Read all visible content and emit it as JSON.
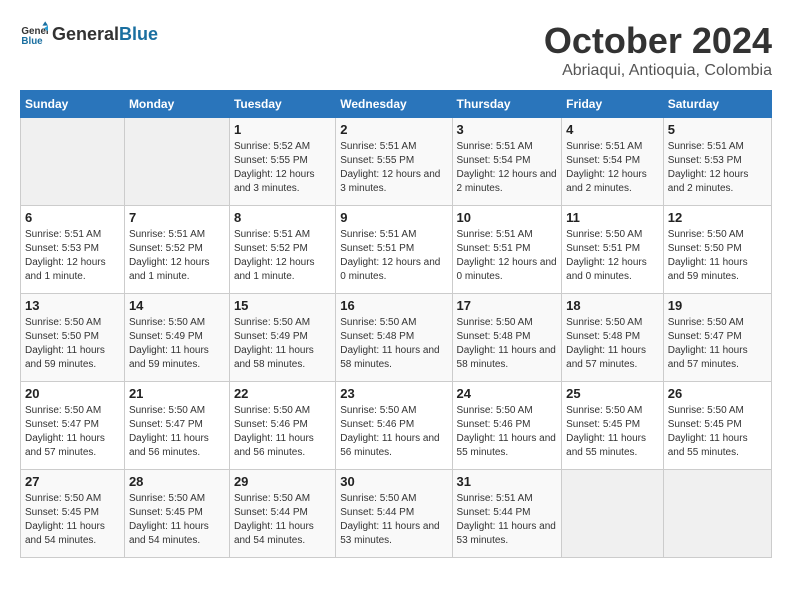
{
  "header": {
    "logo_general": "General",
    "logo_blue": "Blue",
    "month_title": "October 2024",
    "subtitle": "Abriaqui, Antioquia, Colombia"
  },
  "weekdays": [
    "Sunday",
    "Monday",
    "Tuesday",
    "Wednesday",
    "Thursday",
    "Friday",
    "Saturday"
  ],
  "weeks": [
    [
      {
        "day": "",
        "info": ""
      },
      {
        "day": "",
        "info": ""
      },
      {
        "day": "1",
        "info": "Sunrise: 5:52 AM\nSunset: 5:55 PM\nDaylight: 12 hours and 3 minutes."
      },
      {
        "day": "2",
        "info": "Sunrise: 5:51 AM\nSunset: 5:55 PM\nDaylight: 12 hours and 3 minutes."
      },
      {
        "day": "3",
        "info": "Sunrise: 5:51 AM\nSunset: 5:54 PM\nDaylight: 12 hours and 2 minutes."
      },
      {
        "day": "4",
        "info": "Sunrise: 5:51 AM\nSunset: 5:54 PM\nDaylight: 12 hours and 2 minutes."
      },
      {
        "day": "5",
        "info": "Sunrise: 5:51 AM\nSunset: 5:53 PM\nDaylight: 12 hours and 2 minutes."
      }
    ],
    [
      {
        "day": "6",
        "info": "Sunrise: 5:51 AM\nSunset: 5:53 PM\nDaylight: 12 hours and 1 minute."
      },
      {
        "day": "7",
        "info": "Sunrise: 5:51 AM\nSunset: 5:52 PM\nDaylight: 12 hours and 1 minute."
      },
      {
        "day": "8",
        "info": "Sunrise: 5:51 AM\nSunset: 5:52 PM\nDaylight: 12 hours and 1 minute."
      },
      {
        "day": "9",
        "info": "Sunrise: 5:51 AM\nSunset: 5:51 PM\nDaylight: 12 hours and 0 minutes."
      },
      {
        "day": "10",
        "info": "Sunrise: 5:51 AM\nSunset: 5:51 PM\nDaylight: 12 hours and 0 minutes."
      },
      {
        "day": "11",
        "info": "Sunrise: 5:50 AM\nSunset: 5:51 PM\nDaylight: 12 hours and 0 minutes."
      },
      {
        "day": "12",
        "info": "Sunrise: 5:50 AM\nSunset: 5:50 PM\nDaylight: 11 hours and 59 minutes."
      }
    ],
    [
      {
        "day": "13",
        "info": "Sunrise: 5:50 AM\nSunset: 5:50 PM\nDaylight: 11 hours and 59 minutes."
      },
      {
        "day": "14",
        "info": "Sunrise: 5:50 AM\nSunset: 5:49 PM\nDaylight: 11 hours and 59 minutes."
      },
      {
        "day": "15",
        "info": "Sunrise: 5:50 AM\nSunset: 5:49 PM\nDaylight: 11 hours and 58 minutes."
      },
      {
        "day": "16",
        "info": "Sunrise: 5:50 AM\nSunset: 5:48 PM\nDaylight: 11 hours and 58 minutes."
      },
      {
        "day": "17",
        "info": "Sunrise: 5:50 AM\nSunset: 5:48 PM\nDaylight: 11 hours and 58 minutes."
      },
      {
        "day": "18",
        "info": "Sunrise: 5:50 AM\nSunset: 5:48 PM\nDaylight: 11 hours and 57 minutes."
      },
      {
        "day": "19",
        "info": "Sunrise: 5:50 AM\nSunset: 5:47 PM\nDaylight: 11 hours and 57 minutes."
      }
    ],
    [
      {
        "day": "20",
        "info": "Sunrise: 5:50 AM\nSunset: 5:47 PM\nDaylight: 11 hours and 57 minutes."
      },
      {
        "day": "21",
        "info": "Sunrise: 5:50 AM\nSunset: 5:47 PM\nDaylight: 11 hours and 56 minutes."
      },
      {
        "day": "22",
        "info": "Sunrise: 5:50 AM\nSunset: 5:46 PM\nDaylight: 11 hours and 56 minutes."
      },
      {
        "day": "23",
        "info": "Sunrise: 5:50 AM\nSunset: 5:46 PM\nDaylight: 11 hours and 56 minutes."
      },
      {
        "day": "24",
        "info": "Sunrise: 5:50 AM\nSunset: 5:46 PM\nDaylight: 11 hours and 55 minutes."
      },
      {
        "day": "25",
        "info": "Sunrise: 5:50 AM\nSunset: 5:45 PM\nDaylight: 11 hours and 55 minutes."
      },
      {
        "day": "26",
        "info": "Sunrise: 5:50 AM\nSunset: 5:45 PM\nDaylight: 11 hours and 55 minutes."
      }
    ],
    [
      {
        "day": "27",
        "info": "Sunrise: 5:50 AM\nSunset: 5:45 PM\nDaylight: 11 hours and 54 minutes."
      },
      {
        "day": "28",
        "info": "Sunrise: 5:50 AM\nSunset: 5:45 PM\nDaylight: 11 hours and 54 minutes."
      },
      {
        "day": "29",
        "info": "Sunrise: 5:50 AM\nSunset: 5:44 PM\nDaylight: 11 hours and 54 minutes."
      },
      {
        "day": "30",
        "info": "Sunrise: 5:50 AM\nSunset: 5:44 PM\nDaylight: 11 hours and 53 minutes."
      },
      {
        "day": "31",
        "info": "Sunrise: 5:51 AM\nSunset: 5:44 PM\nDaylight: 11 hours and 53 minutes."
      },
      {
        "day": "",
        "info": ""
      },
      {
        "day": "",
        "info": ""
      }
    ]
  ]
}
